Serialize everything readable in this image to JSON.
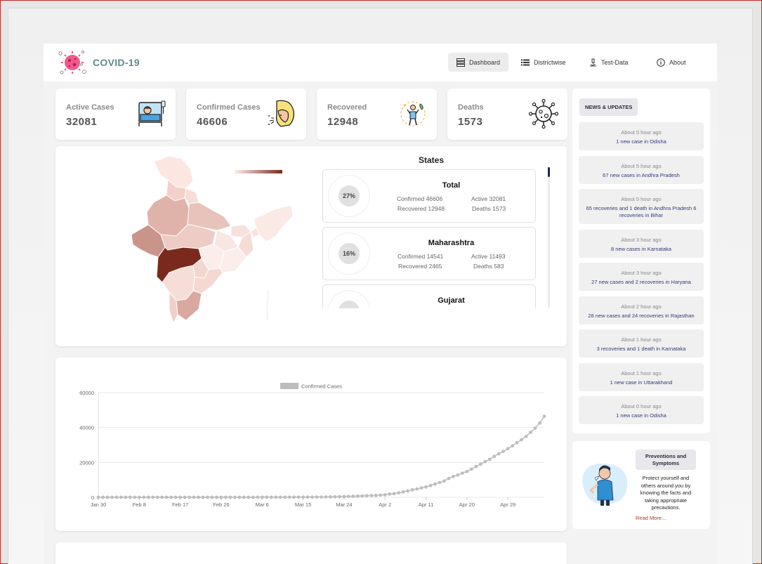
{
  "app": {
    "title": "COVID-19"
  },
  "nav": {
    "dashboard": "Dashboard",
    "districtwise": "Districtwise",
    "test_data": "Test-Data",
    "about": "About"
  },
  "stats": [
    {
      "label": "Active Cases",
      "value": "32081",
      "icon": "patient-bed-icon"
    },
    {
      "label": "Confirmed Cases",
      "value": "46606",
      "icon": "coughing-person-icon"
    },
    {
      "label": "Recovered",
      "value": "12948",
      "icon": "recovered-person-icon"
    },
    {
      "label": "Deaths",
      "value": "1573",
      "icon": "virus-icon"
    }
  ],
  "map": {
    "colors": {
      "low": "#fbeeea",
      "high": "#7a2a1c"
    }
  },
  "states": {
    "title": "States",
    "items": [
      {
        "name": "Total",
        "percent": "27%",
        "confirmed": "Confirmed 46606",
        "active": "Active 32081",
        "recovered": "Recovered 12948",
        "deaths": "Deaths 1573"
      },
      {
        "name": "Maharashtra",
        "percent": "16%",
        "confirmed": "Confirmed 14541",
        "active": "Active 11493",
        "recovered": "Recovered 2465",
        "deaths": "Deaths 583"
      },
      {
        "name": "Gujarat",
        "percent": "",
        "confirmed": "",
        "active": "",
        "recovered": "",
        "deaths": ""
      }
    ]
  },
  "chart_data": {
    "type": "line",
    "legend": [
      "Confirmed Cases"
    ],
    "xlabel": "",
    "ylabel": "",
    "ylim": [
      0,
      60000
    ],
    "yticks": [
      "60000",
      "40000",
      "20000",
      "0"
    ],
    "xticks": [
      "Jan 30",
      "Feb 8",
      "Feb 17",
      "Feb 26",
      "Mar 6",
      "Mar 15",
      "Mar 24",
      "Apr 2",
      "Apr 11",
      "Apr 20",
      "Apr 29"
    ],
    "series": [
      {
        "name": "Confirmed Cases",
        "color": "#bdbdbd",
        "x_start": "Jan 30",
        "values": [
          1,
          1,
          2,
          3,
          3,
          3,
          3,
          3,
          3,
          3,
          3,
          3,
          3,
          3,
          3,
          3,
          3,
          3,
          3,
          3,
          3,
          3,
          3,
          3,
          3,
          3,
          3,
          3,
          3,
          3,
          3,
          3,
          3,
          5,
          6,
          28,
          30,
          31,
          34,
          39,
          44,
          50,
          73,
          75,
          83,
          90,
          102,
          112,
          126,
          146,
          171,
          198,
          256,
          334,
          403,
          497,
          571,
          657,
          735,
          887,
          987,
          1024,
          1251,
          1397,
          1834,
          2069,
          2547,
          3082,
          3588,
          4289,
          4778,
          5351,
          5916,
          6725,
          7599,
          8447,
          9352,
          10815,
          11933,
          12759,
          13835,
          14792,
          16116,
          17656,
          18985,
          20471,
          21700,
          23452,
          24942,
          26283,
          27890,
          29451,
          31324,
          33062,
          34863,
          37257,
          39699,
          42533,
          46433
        ]
      }
    ]
  },
  "news": {
    "title": "NEWS & UPDATES",
    "items": [
      {
        "time": "About 5 hour ago",
        "text": "1 new case in Odisha"
      },
      {
        "time": "About 5 hour ago",
        "text": "67 new cases in Andhra Pradesh"
      },
      {
        "time": "About 5 hour ago",
        "text": "65 recoveries and 1 death in Andhra Pradesh 6 recoveries in Bihar"
      },
      {
        "time": "About 3 hour ago",
        "text": "8 new cases in Karnataka"
      },
      {
        "time": "About 3 hour ago",
        "text": "27 new cases and 2 recoveries in Haryana"
      },
      {
        "time": "About 2 hour ago",
        "text": "28 new cases and 24 recoveries in Rajasthan"
      },
      {
        "time": "About 1 hour ago",
        "text": "3 recoveries and 1 death in Karnataka"
      },
      {
        "time": "About 1 hour ago",
        "text": "1 new case in Uttarakhand"
      },
      {
        "time": "About 0 hour ago",
        "text": "1 new case in Odisha"
      }
    ]
  },
  "prevention": {
    "title": "Preventions and Symptoms",
    "text": "Protect yourself and others around you by knowing the facts and taking appropriate precautions.",
    "link": "Read More..."
  }
}
